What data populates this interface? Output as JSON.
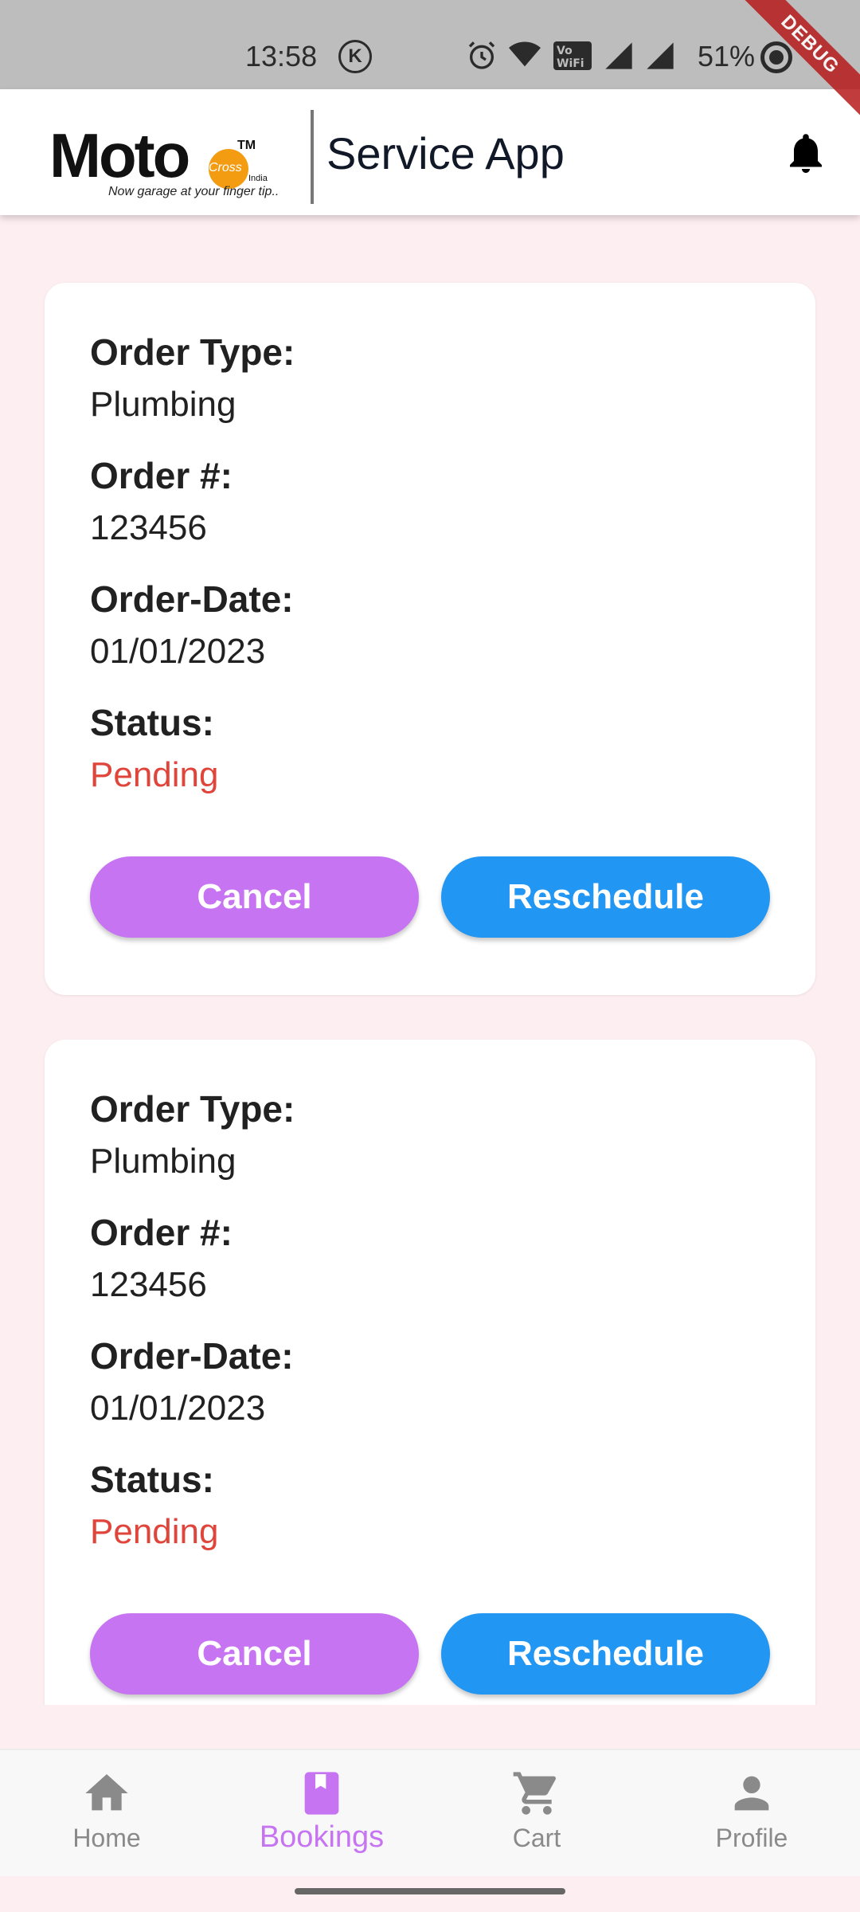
{
  "status_bar": {
    "time": "13:58",
    "k_badge": "K",
    "battery": "51%",
    "debug_banner": "DEBUG",
    "icons": [
      "alarm-icon",
      "wifi-icon",
      "vowifi-icon",
      "signal-icon",
      "signal-icon",
      "record-icon"
    ]
  },
  "app_bar": {
    "logo": {
      "name": "Moto",
      "mark": "Cross",
      "tm": "TM",
      "country": "India",
      "tagline": "Now garage at your finger tip.."
    },
    "title": "Service App",
    "notification_icon": "bell-icon"
  },
  "bookings": [
    {
      "order_type_label": "Order Type:",
      "order_type": "Plumbing",
      "order_number_label": "Order #:",
      "order_number": "123456",
      "order_date_label": "Order-Date:",
      "order_date": "01/01/2023",
      "status_label": "Status:",
      "status": "Pending",
      "cancel_label": "Cancel",
      "reschedule_label": "Reschedule"
    },
    {
      "order_type_label": "Order Type:",
      "order_type": "Plumbing",
      "order_number_label": "Order #:",
      "order_number": "123456",
      "order_date_label": "Order-Date:",
      "order_date": "01/01/2023",
      "status_label": "Status:",
      "status": "Pending",
      "cancel_label": "Cancel",
      "reschedule_label": "Reschedule"
    }
  ],
  "bottom_nav": {
    "items": [
      {
        "label": "Home",
        "icon": "home-icon"
      },
      {
        "label": "Bookings",
        "icon": "bookmark-icon",
        "active": true
      },
      {
        "label": "Cart",
        "icon": "cart-icon"
      },
      {
        "label": "Profile",
        "icon": "person-icon"
      }
    ]
  },
  "colors": {
    "background": "#fdeef1",
    "accent_purple": "#c774f2",
    "accent_blue": "#2196f3",
    "status_pending": "#e0453c"
  }
}
